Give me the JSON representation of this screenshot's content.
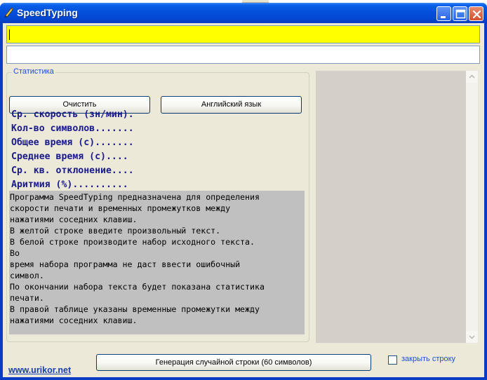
{
  "window": {
    "title": "SpeedTyping"
  },
  "inputs": {
    "reference_text": "",
    "typing_text": ""
  },
  "buttons": {
    "clear": "Очистить",
    "language": "Английский язык",
    "generate": "Генерация случайной строки (60 символов)"
  },
  "stats_group": {
    "legend": "Статистика"
  },
  "stats": [
    "Ср. скорость (зн/мин).",
    "Кол-во символов.......",
    "Общее время (с).......",
    "Среднее время (с)....",
    "Ср. кв. отклонение....",
    "Аритмия (%).........."
  ],
  "info_lines": [
    "Программа SpeedTyping предназначена для определения",
    "скорости печати и временных промежутков между",
    "нажатиями соседних клавиш.",
    "В желтой строке введите произвольный текст.",
    "В белой строке производите набор исходного текста.",
    "Во",
    "время набора программа не даст ввести ошибочный",
    "символ.",
    "По окончании набора текста будет показана статистика",
    "печати.",
    "В правой таблице указаны временные промежутки между",
    "нажатиями соседних клавиш."
  ],
  "footer": {
    "link": "www.urikor.net",
    "checkbox_label": "закрыть строку",
    "checkbox_checked": false
  },
  "colors": {
    "reference_field": "#ffff00",
    "stats_text": "#1a1a8a",
    "title_bar": "#0450da"
  }
}
